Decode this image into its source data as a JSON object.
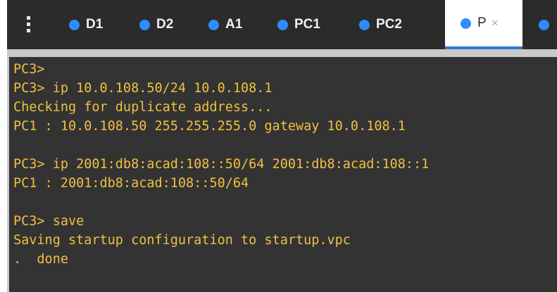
{
  "tabs": [
    {
      "label": "D1",
      "status_color": "#2f8cff",
      "active": false
    },
    {
      "label": "D2",
      "status_color": "#2f8cff",
      "active": false
    },
    {
      "label": "A1",
      "status_color": "#2f8cff",
      "active": false
    },
    {
      "label": "PC1",
      "status_color": "#2f8cff",
      "active": false
    },
    {
      "label": "PC2",
      "status_color": "#2f8cff",
      "active": false
    },
    {
      "label": "P",
      "status_color": "#2f8cff",
      "active": true,
      "close": "×"
    },
    {
      "label": "",
      "status_color": "#2f8cff",
      "active": false
    }
  ],
  "terminal": {
    "text_color": "#f0c040",
    "background": "#333333",
    "lines": [
      "PC3>",
      "PC3> ip 10.0.108.50/24 10.0.108.1",
      "Checking for duplicate address...",
      "PC1 : 10.0.108.50 255.255.255.0 gateway 10.0.108.1",
      "",
      "PC3> ip 2001:db8:acad:108::50/64 2001:db8:acad:108::1",
      "PC1 : 2001:db8:acad:108::50/64",
      "",
      "PC3> save",
      "Saving startup configuration to startup.vpc",
      ".  done"
    ]
  }
}
